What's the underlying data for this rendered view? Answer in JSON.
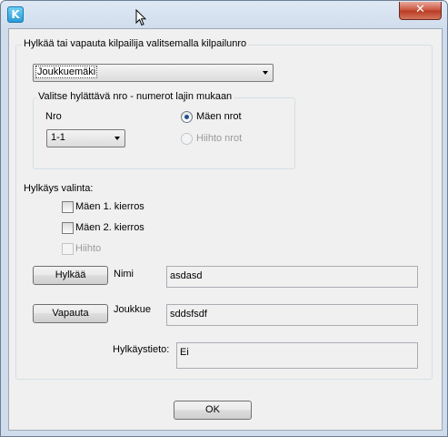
{
  "window": {
    "close_glyph": "✕"
  },
  "main_group": {
    "title": "Hylkää tai vapauta kilpailija valitsemalla kilpailunro",
    "competition_select": "Joukkuemäki"
  },
  "number_group": {
    "title": "Valitse hylättävä nro - numerot lajin mukaan",
    "nro_label": "Nro",
    "nro_select": "1-1",
    "radio_jump": "Mäen nrot",
    "radio_ski": "Hiihto nrot",
    "radio_jump_selected": true
  },
  "disqualification": {
    "label": "Hylkäys valinta:",
    "options": [
      {
        "label": "Mäen 1. kierros",
        "checked": false,
        "enabled": true
      },
      {
        "label": "Mäen 2. kierros",
        "checked": false,
        "enabled": true
      },
      {
        "label": "Hiihto",
        "checked": false,
        "enabled": false
      }
    ]
  },
  "actions": {
    "disqualify_button": "Hylkää",
    "release_button": "Vapauta",
    "name_label": "Nimi",
    "name_value": "asdasd",
    "team_label": "Joukkue",
    "team_value": "sddsfsdf",
    "info_label": "Hylkäystieto:",
    "info_value": "Ei"
  },
  "footer": {
    "ok_button": "OK"
  }
}
